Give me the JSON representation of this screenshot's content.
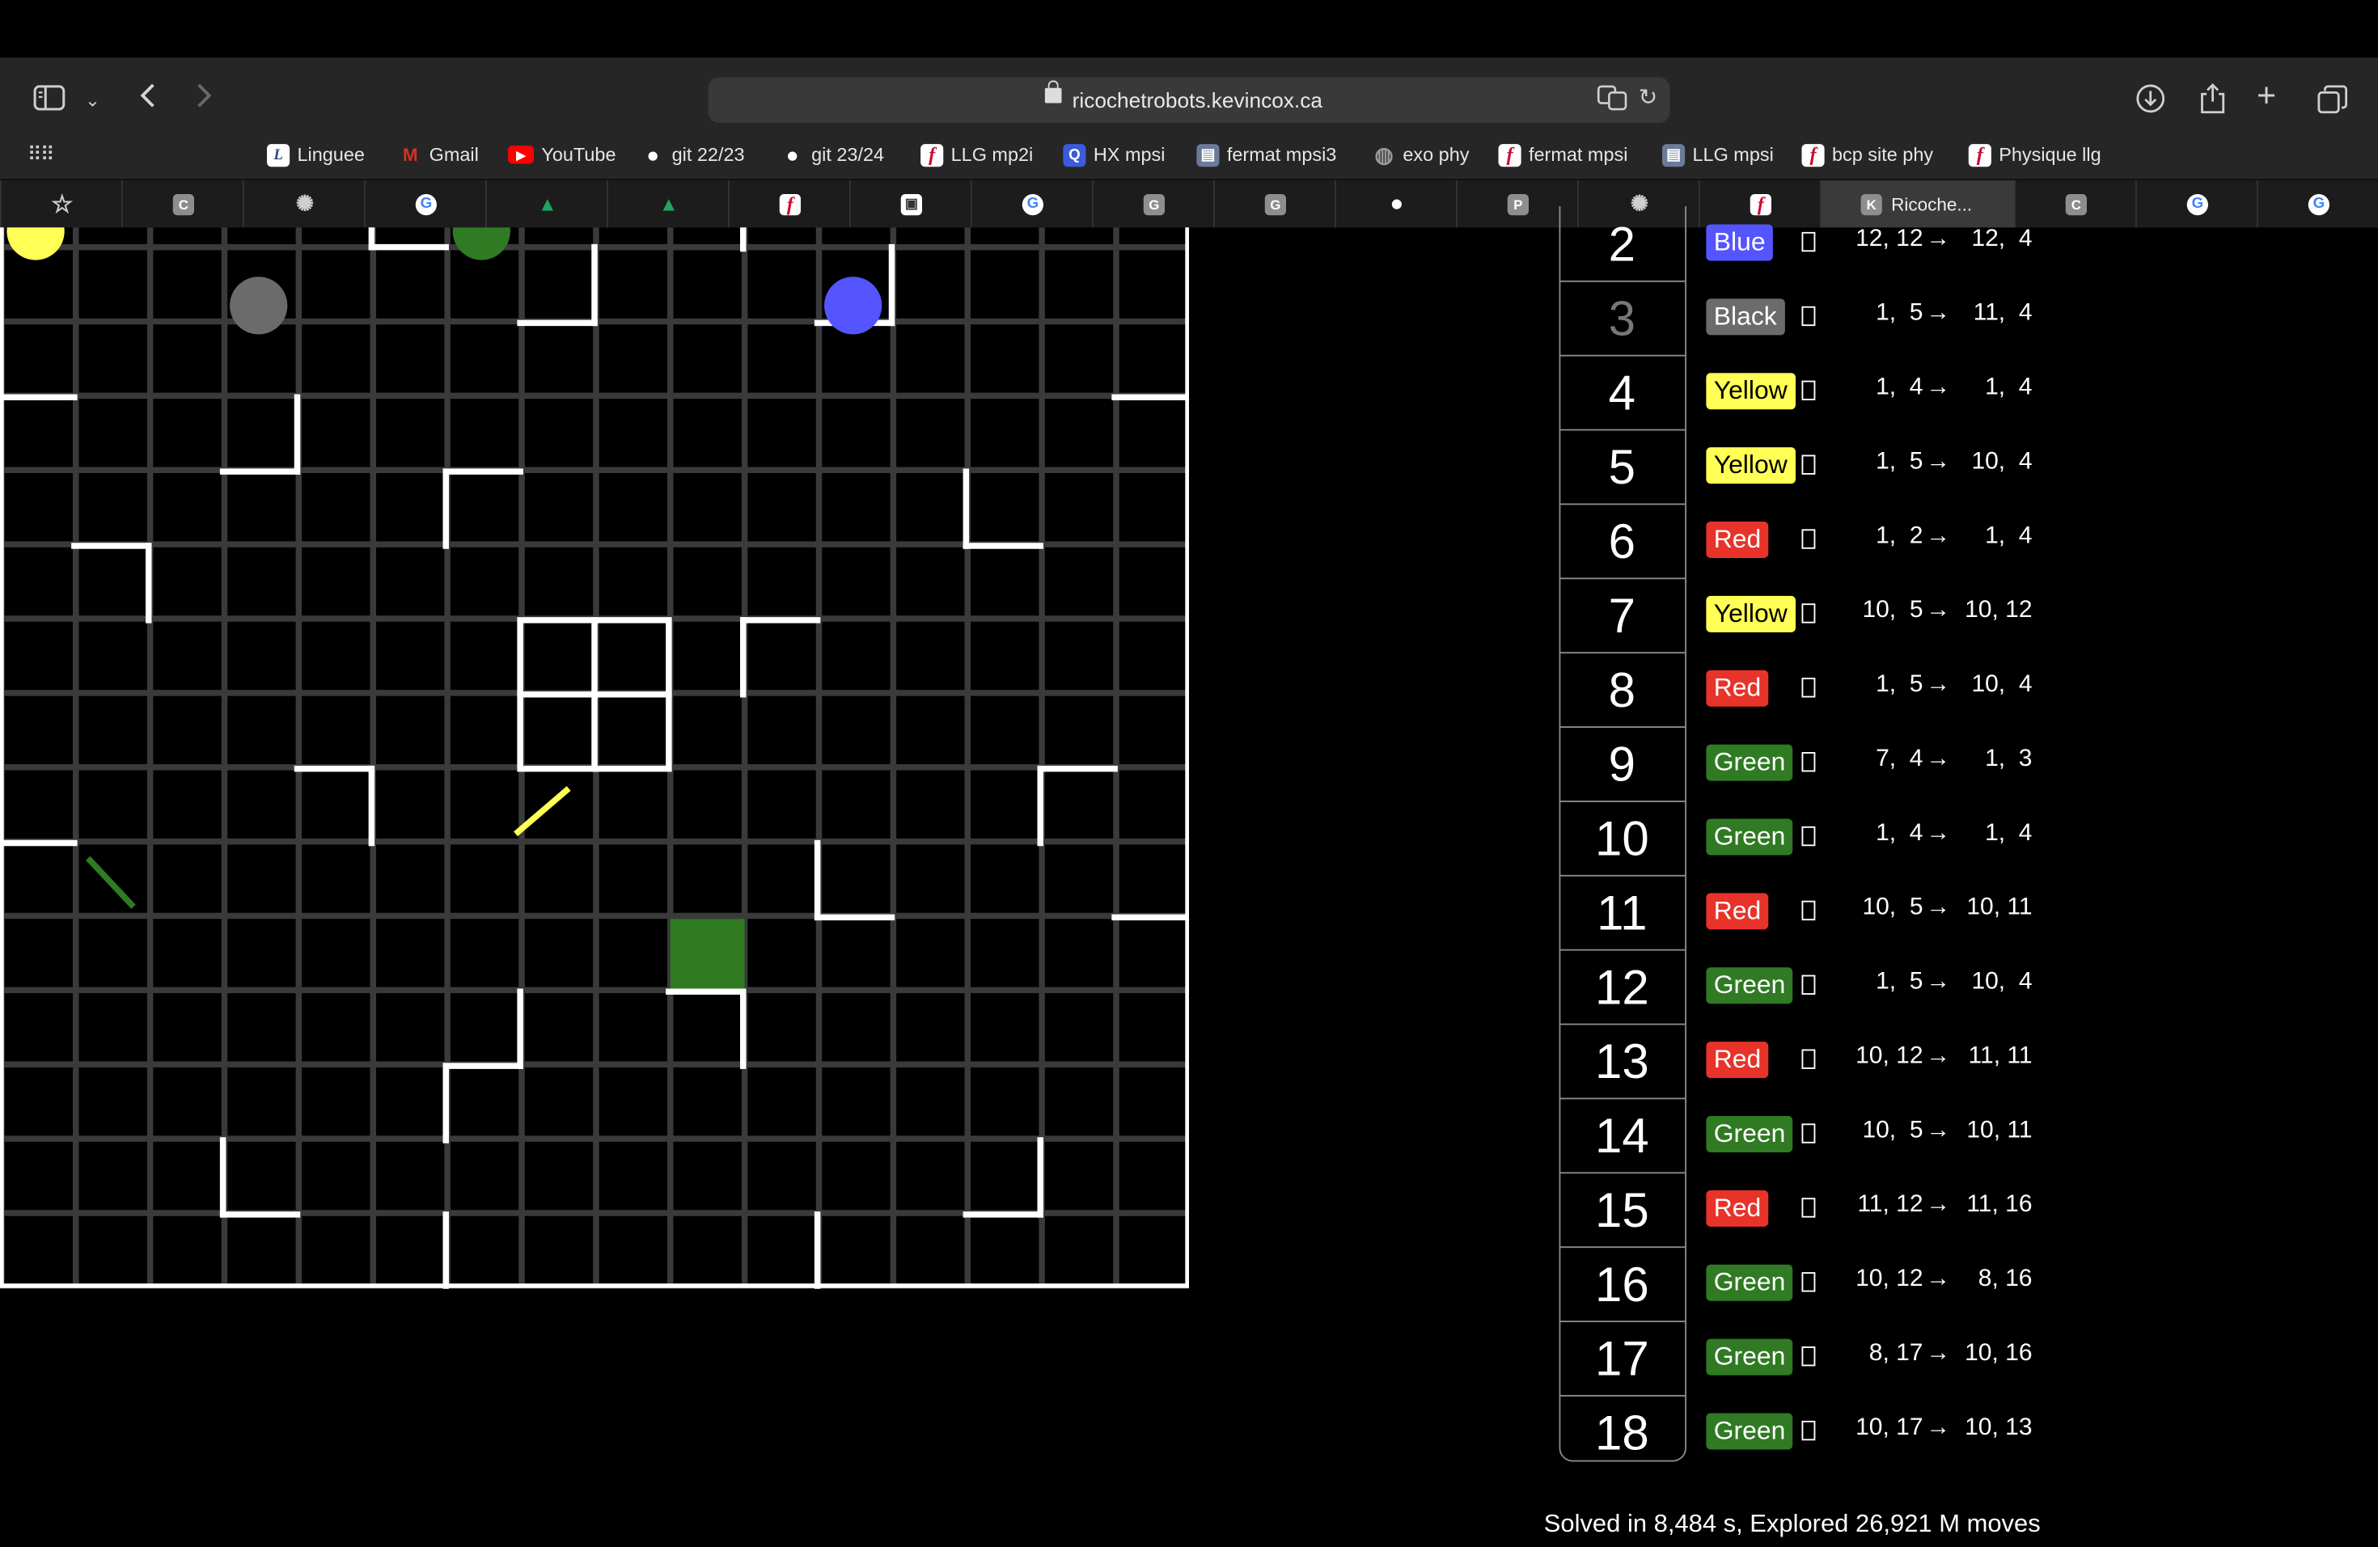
{
  "browser": {
    "url": "ricochetrobots.kevincox.ca",
    "bookmarks": [
      {
        "label": "Linguee",
        "icon": "linguee-icon",
        "color": "#4a6fa5"
      },
      {
        "label": "Gmail",
        "icon": "gmail-icon",
        "color": "#d93025"
      },
      {
        "label": "YouTube",
        "icon": "youtube-icon",
        "color": "#ff0000"
      },
      {
        "label": "git 22/23",
        "icon": "github-icon",
        "color": "#ffffff"
      },
      {
        "label": "git 23/24",
        "icon": "github-icon",
        "color": "#ffffff"
      },
      {
        "label": "LLG mp2i",
        "icon": "flash-icon",
        "color": "#c8102e"
      },
      {
        "label": "HX mpsi",
        "icon": "q-icon",
        "color": "#3b5bdb"
      },
      {
        "label": "fermat mpsi3",
        "icon": "site-icon",
        "color": "#6b7a99"
      },
      {
        "label": "exo phy",
        "icon": "globe-icon",
        "color": "#9a9a9a"
      },
      {
        "label": "fermat mpsi",
        "icon": "flash-icon",
        "color": "#c8102e"
      },
      {
        "label": "LLG mpsi",
        "icon": "site-icon",
        "color": "#6b7a99"
      },
      {
        "label": "bcp site phy",
        "icon": "flash-icon",
        "color": "#c8102e"
      },
      {
        "label": "Physique llg",
        "icon": "flash-icon",
        "color": "#c8102e"
      }
    ],
    "tabs": [
      {
        "icon": "star-icon",
        "glyph": "☆",
        "color": "#262626"
      },
      {
        "icon": "c-icon",
        "glyph": "C",
        "color": "#8e8e8e"
      },
      {
        "icon": "chatgpt-icon",
        "glyph": "✺",
        "color": "#74aa9c"
      },
      {
        "icon": "google-icon",
        "glyph": "G",
        "color": "#ffffff"
      },
      {
        "icon": "drive-icon",
        "glyph": "▲",
        "color": "#1fa463"
      },
      {
        "icon": "drive-icon",
        "glyph": "▲",
        "color": "#1fa463"
      },
      {
        "icon": "flash-icon",
        "glyph": "f",
        "color": "#c8102e"
      },
      {
        "icon": "image-icon",
        "glyph": "▣",
        "color": "#777777"
      },
      {
        "icon": "google-icon",
        "glyph": "G",
        "color": "#ffffff"
      },
      {
        "icon": "g-icon",
        "glyph": "G",
        "color": "#8e8e8e"
      },
      {
        "icon": "g-icon",
        "glyph": "G",
        "color": "#8e8e8e"
      },
      {
        "icon": "github-icon",
        "glyph": "●",
        "color": "#262626"
      },
      {
        "icon": "p-icon",
        "glyph": "P",
        "color": "#8e8e8e"
      },
      {
        "icon": "chatgpt-icon",
        "glyph": "✺",
        "color": "#74aa9c"
      },
      {
        "icon": "flash-icon",
        "glyph": "f",
        "color": "#c8102e"
      },
      {
        "icon": "k-icon",
        "glyph": "K",
        "color": "#8e8e8e",
        "title": "Ricoche...",
        "active": true
      },
      {
        "icon": "c-icon",
        "glyph": "C",
        "color": "#8e8e8e"
      },
      {
        "icon": "google-icon",
        "glyph": "G",
        "color": "#ffffff"
      },
      {
        "icon": "google-icon",
        "glyph": "G",
        "color": "#ffffff"
      }
    ]
  },
  "board": {
    "cols": 16,
    "robots": [
      {
        "color": "#ffff55",
        "col": 0,
        "row": 0
      },
      {
        "color": "#2f7a23",
        "col": 6,
        "row": 0
      },
      {
        "color": "#6b6b6b",
        "col": 3,
        "row": 1
      },
      {
        "color": "#5555ff",
        "col": 11,
        "row": 1
      }
    ],
    "target": {
      "color": "#2f7a23",
      "col": 9,
      "row": 10
    },
    "diagonals": [
      {
        "color": "#ffff55",
        "col": 7,
        "row": 8,
        "dir": "/"
      },
      {
        "color": "#2f7a23",
        "col": 1,
        "row": 9,
        "dir": "\\"
      }
    ]
  },
  "moves": [
    {
      "n": "2",
      "robot": "Blue",
      "color": "#5555ff",
      "from": "12, 12",
      "to": "12,  4"
    },
    {
      "n": "3",
      "robot": "Black",
      "color": "#6b6b6b",
      "from": "1,  5",
      "to": "11,  4",
      "dim": true
    },
    {
      "n": "4",
      "robot": "Yellow",
      "color": "#ffff55",
      "from": "1,  4",
      "to": "1,  4"
    },
    {
      "n": "5",
      "robot": "Yellow",
      "color": "#ffff55",
      "from": "1,  5",
      "to": "10,  4"
    },
    {
      "n": "6",
      "robot": "Red",
      "color": "#e8332a",
      "from": "1,  2",
      "to": "1,  4"
    },
    {
      "n": "7",
      "robot": "Yellow",
      "color": "#ffff55",
      "from": "10,  5",
      "to": "10, 12"
    },
    {
      "n": "8",
      "robot": "Red",
      "color": "#e8332a",
      "from": "1,  5",
      "to": "10,  4"
    },
    {
      "n": "9",
      "robot": "Green",
      "color": "#2f7a23",
      "from": "7,  4",
      "to": "1,  3"
    },
    {
      "n": "10",
      "robot": "Green",
      "color": "#2f7a23",
      "from": "1,  4",
      "to": "1,  4"
    },
    {
      "n": "11",
      "robot": "Red",
      "color": "#e8332a",
      "from": "10,  5",
      "to": "10, 11"
    },
    {
      "n": "12",
      "robot": "Green",
      "color": "#2f7a23",
      "from": "1,  5",
      "to": "10,  4"
    },
    {
      "n": "13",
      "robot": "Red",
      "color": "#e8332a",
      "from": "10, 12",
      "to": "11, 11"
    },
    {
      "n": "14",
      "robot": "Green",
      "color": "#2f7a23",
      "from": "10,  5",
      "to": "10, 11"
    },
    {
      "n": "15",
      "robot": "Red",
      "color": "#e8332a",
      "from": "11, 12",
      "to": "11, 16"
    },
    {
      "n": "16",
      "robot": "Green",
      "color": "#2f7a23",
      "from": "10, 12",
      "to": "8, 16"
    },
    {
      "n": "17",
      "robot": "Green",
      "color": "#2f7a23",
      "from": "8, 17",
      "to": "10, 16"
    },
    {
      "n": "18",
      "robot": "Green",
      "color": "#2f7a23",
      "from": "10, 17",
      "to": "10, 13"
    }
  ],
  "arrow": "→",
  "status": "Solved in 8,484 s, Explored 26,921 M moves"
}
